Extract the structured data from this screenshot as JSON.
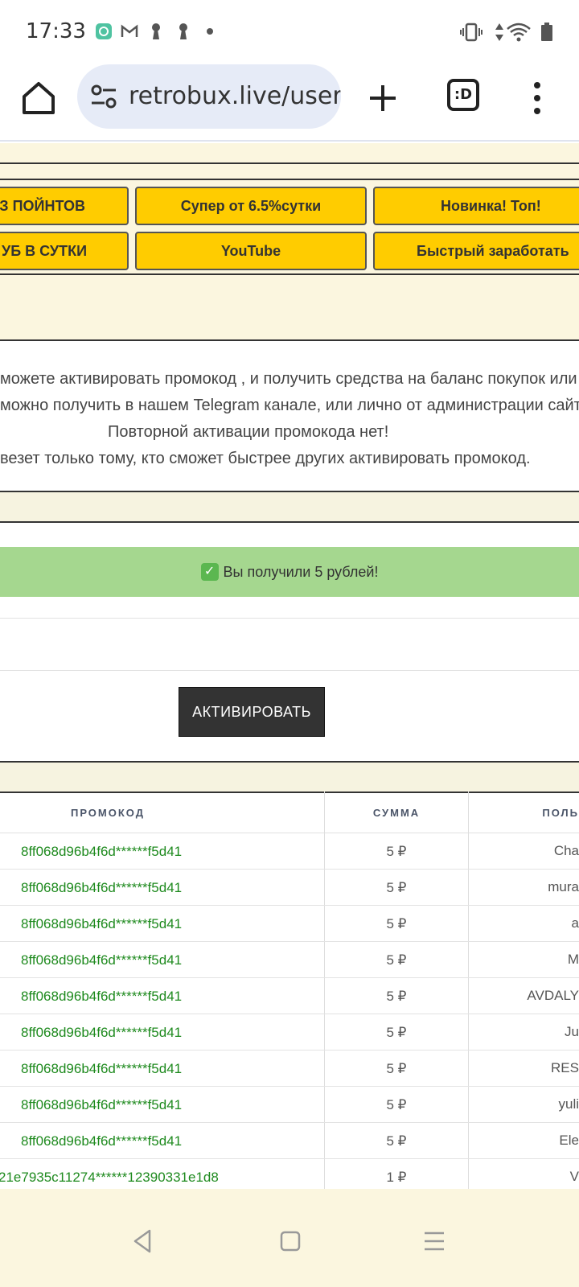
{
  "status_bar": {
    "time": "17:33",
    "left_icons": [
      "app-icon",
      "gmail-icon",
      "keyhole-icon",
      "keyhole-icon",
      "dot-icon"
    ],
    "right_icons": [
      "vibrate-icon",
      "data-arrows-icon",
      "wifi-icon",
      "battery-icon"
    ]
  },
  "browser": {
    "url": "retrobux.live/user",
    "tabs_label": ":D"
  },
  "nav_buttons": {
    "row1": [
      "ЕЗ ПОЙНТОВ",
      "Супер от 6.5%сутки",
      "Новинка! Топ!"
    ],
    "row2": [
      "УБ В СУТКИ",
      "YouTube",
      "Быстрый заработать"
    ]
  },
  "info": {
    "line1": "можете активировать промокод , и получить средства на баланс покупок или",
    "line2": "можно получить в нашем Telegram канале, или лично от администрации сайта",
    "line3": "Повторной активации промокода нет!",
    "line4": "везет только тому, кто сможет быстрее других активировать промокод."
  },
  "success": {
    "icon": "check-mark-icon",
    "message": "Вы получили 5 рублей!",
    "color": "#a5d78f"
  },
  "promo_input": {
    "value": "",
    "placeholder": ""
  },
  "activate_button": "АКТИВИРОВАТЬ",
  "table": {
    "headers": [
      "ПРОМОКОД",
      "СУММА",
      "ПОЛЬ"
    ],
    "rows": [
      {
        "code": "8ff068d96b4f6d******f5d41",
        "sum": "5 ₽",
        "user": "Cha"
      },
      {
        "code": "8ff068d96b4f6d******f5d41",
        "sum": "5 ₽",
        "user": "mura"
      },
      {
        "code": "8ff068d96b4f6d******f5d41",
        "sum": "5 ₽",
        "user": "a"
      },
      {
        "code": "8ff068d96b4f6d******f5d41",
        "sum": "5 ₽",
        "user": "M"
      },
      {
        "code": "8ff068d96b4f6d******f5d41",
        "sum": "5 ₽",
        "user": "AVDALY"
      },
      {
        "code": "8ff068d96b4f6d******f5d41",
        "sum": "5 ₽",
        "user": "Ju"
      },
      {
        "code": "8ff068d96b4f6d******f5d41",
        "sum": "5 ₽",
        "user": "RES"
      },
      {
        "code": "8ff068d96b4f6d******f5d41",
        "sum": "5 ₽",
        "user": "yuli"
      },
      {
        "code": "8ff068d96b4f6d******f5d41",
        "sum": "5 ₽",
        "user": "Ele"
      },
      {
        "code": "21e7935c11274******12390331e1d8",
        "sum": "1 ₽",
        "user": "V"
      }
    ]
  },
  "colors": {
    "accent_yellow": "#ffcc00",
    "cream": "#fbf6df",
    "code_green": "#1e8a1e",
    "button_dark": "#333333"
  }
}
